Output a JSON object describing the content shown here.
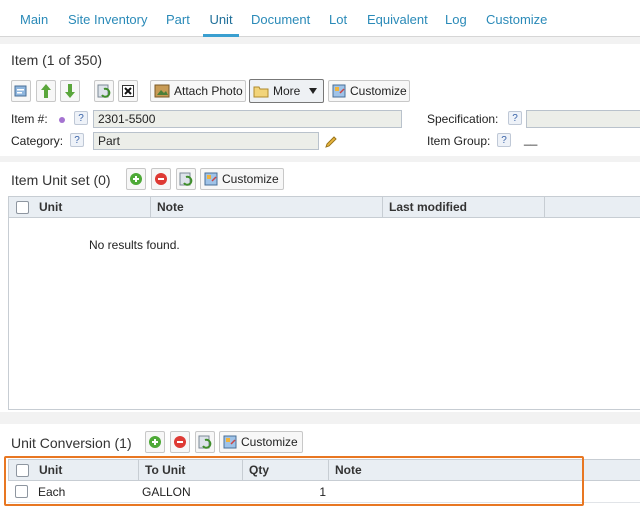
{
  "tabs": [
    {
      "label": "Main",
      "active": false
    },
    {
      "label": "Site Inventory",
      "active": false
    },
    {
      "label": "Part",
      "active": false
    },
    {
      "label": "Unit",
      "active": true
    },
    {
      "label": "Document",
      "active": false
    },
    {
      "label": "Lot",
      "active": false
    },
    {
      "label": "Equivalent",
      "active": false
    },
    {
      "label": "Log",
      "active": false
    },
    {
      "label": "Customize",
      "active": false
    }
  ],
  "item": {
    "title": "Item (1 of 350)",
    "toolbar": {
      "attach_photo": "Attach Photo",
      "more": "More",
      "customize": "Customize"
    },
    "item_no_label": "Item #:",
    "item_no_value": "2301-5500",
    "category_label": "Category:",
    "category_value": "Part",
    "specification_label": "Specification:",
    "specification_value": "",
    "item_group_label": "Item Group:",
    "item_group_value": "__",
    "help_glyph": "?"
  },
  "unit_set": {
    "title": "Item Unit set (0)",
    "customize": "Customize",
    "columns": [
      "Unit",
      "Note",
      "Last modified"
    ],
    "empty_text": "No results found."
  },
  "unit_conversion": {
    "title": "Unit Conversion (1)",
    "customize": "Customize",
    "columns": [
      "Unit",
      "To Unit",
      "Qty",
      "Note"
    ],
    "rows": [
      {
        "unit": "Each",
        "to_unit": "GALLON",
        "qty": "1",
        "note": ""
      }
    ]
  },
  "colors": {
    "accent": "#2a8ab8",
    "highlight": "#e87722"
  }
}
